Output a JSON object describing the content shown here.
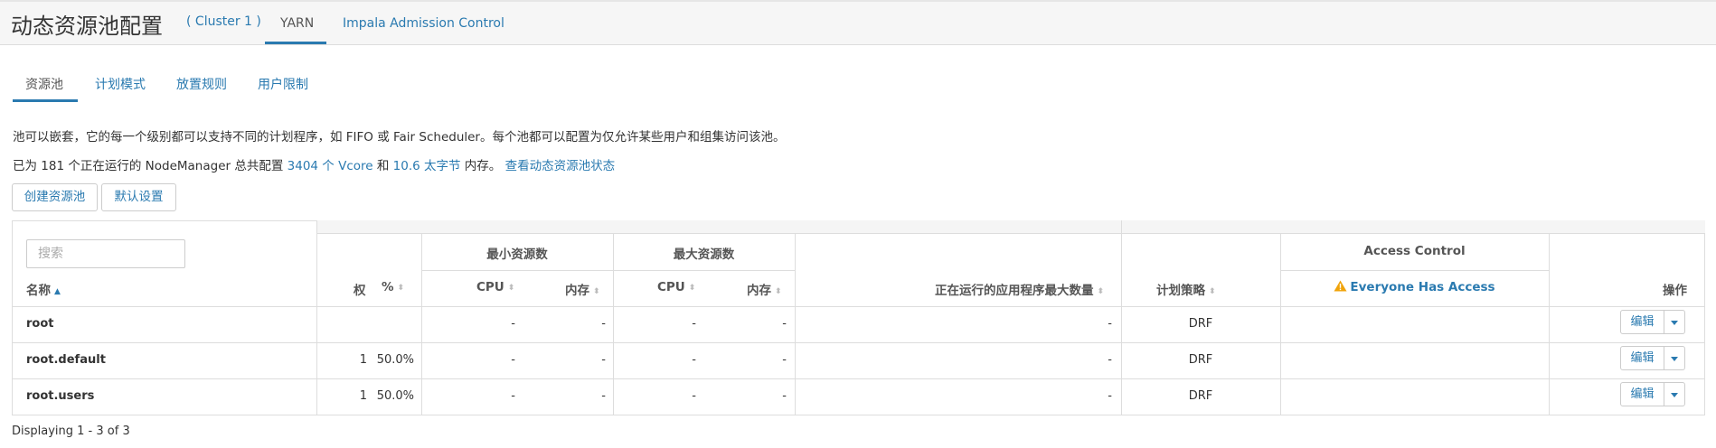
{
  "header": {
    "title": "动态资源池配置",
    "cluster": "( Cluster 1 )",
    "tabs": [
      "YARN",
      "Impala Admission Control"
    ]
  },
  "subtabs": [
    "资源池",
    "计划模式",
    "放置规则",
    "用户限制"
  ],
  "description": {
    "line1": "池可以嵌套，它的每一个级别都可以支持不同的计划程序，如 FIFO 或 Fair Scheduler。每个池都可以配置为仅允许某些用户和组集访问该池。",
    "line2_prefix": "已为 181 个正在运行的 NodeManager 总共配置 ",
    "vcores": "3404 个 Vcore",
    "and": " 和 ",
    "memory": "10.6 太字节",
    "line2_suffix": " 内存。 ",
    "status_link": "查看动态资源池状态"
  },
  "buttons": {
    "create_pool": "创建资源池",
    "defaults": "默认设置"
  },
  "search": {
    "placeholder": "搜索"
  },
  "table": {
    "group_headers": {
      "min_resources": "最小资源数",
      "max_resources": "最大资源数",
      "access_control": "Access Control"
    },
    "columns": {
      "name": "名称",
      "weight": "权",
      "percent": "%",
      "min_cpu": "CPU",
      "min_mem": "内存",
      "max_cpu": "CPU",
      "max_mem": "内存",
      "max_running_apps": "正在运行的应用程序最大数量",
      "scheduling_policy": "计划策略",
      "access": "Everyone Has Access",
      "actions": "操作"
    },
    "rows": [
      {
        "name": "root",
        "weight": "",
        "percent": "",
        "min_cpu": "-",
        "min_mem": "-",
        "max_cpu": "-",
        "max_mem": "-",
        "max_apps": "-",
        "policy": "DRF",
        "edit": "编辑"
      },
      {
        "name": "root.default",
        "weight": "1",
        "percent": "50.0%",
        "min_cpu": "-",
        "min_mem": "-",
        "max_cpu": "-",
        "max_mem": "-",
        "max_apps": "-",
        "policy": "DRF",
        "edit": "编辑"
      },
      {
        "name": "root.users",
        "weight": "1",
        "percent": "50.0%",
        "min_cpu": "-",
        "min_mem": "-",
        "max_cpu": "-",
        "max_mem": "-",
        "max_apps": "-",
        "policy": "DRF",
        "edit": "编辑"
      }
    ]
  },
  "footer": "Displaying 1 - 3 of 3",
  "colors": {
    "link": "#2a7ab0",
    "warning": "#f0a30a"
  }
}
